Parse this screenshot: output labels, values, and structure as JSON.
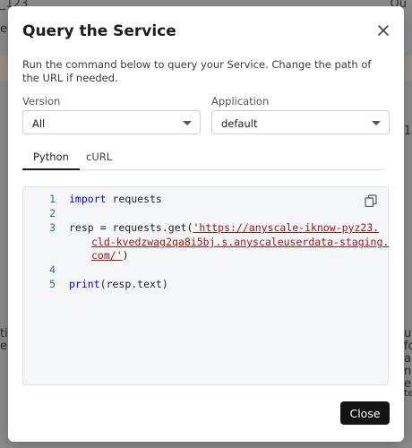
{
  "background": {
    "top_left_text": "_123",
    "top_right_text": "Qu",
    "left_fragment_1": "es",
    "right_fragment_1": "123",
    "left_fragments": [
      "ti",
      "e"
    ],
    "right_fragments": [
      "ut",
      "fo",
      "ac",
      "na",
      "e"
    ],
    "right_fragment_2": "te"
  },
  "dialog": {
    "title": "Query the Service",
    "description": "Run the command below to query your Service. Change the path of the URL if needed.",
    "version": {
      "label": "Version",
      "value": "All"
    },
    "application": {
      "label": "Application",
      "value": "default"
    },
    "tabs": [
      {
        "label": "Python",
        "active": true
      },
      {
        "label": "cURL",
        "active": false
      }
    ],
    "code": {
      "line_numbers": [
        "1",
        "2",
        "3",
        "4",
        "5"
      ],
      "line1_kw": "import",
      "line1_rest": " requests",
      "line3_prefix": "resp = requests.get(",
      "url_part1": "'https://anyscale-iknow-pyz23.",
      "url_part2": "cld-kvedzwag2qa8i5bj.s.anyscaleuserdata-staging.",
      "url_part3": "com/'",
      "line3_suffix": ")",
      "line5_kw": "print",
      "line5_rest": "(resp.text)"
    },
    "close_button": "Close"
  },
  "colors": {
    "keyword": "#0000ff",
    "string": "#a31515",
    "line_number": "#237893",
    "primary_button": "#141414"
  },
  "icons": [
    "close-icon",
    "copy-icon",
    "chevron-down-icon"
  ]
}
